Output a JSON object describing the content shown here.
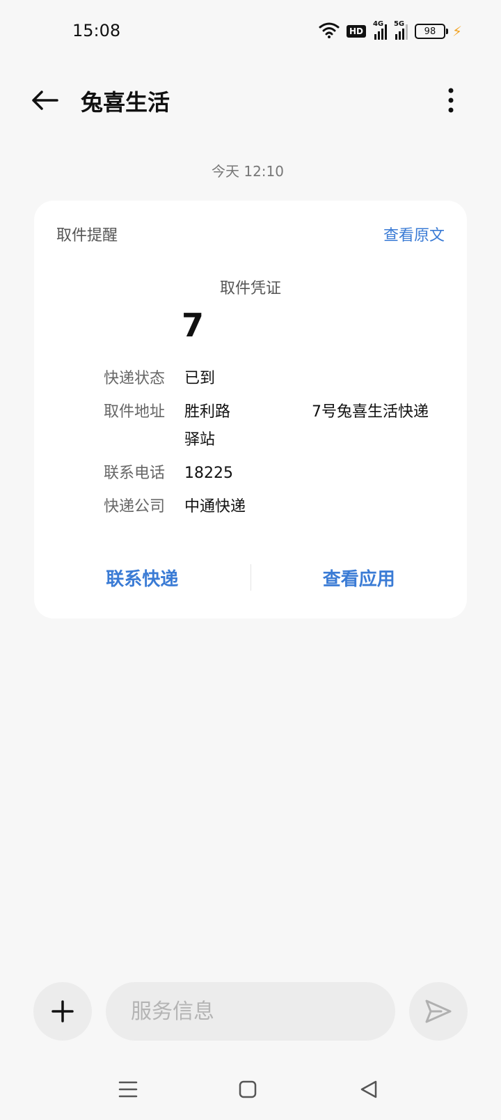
{
  "status_bar": {
    "time": "15:08",
    "hd_label": "HD",
    "network_4g": "4G",
    "network_5g": "5G",
    "battery_level": "98"
  },
  "header": {
    "title": "兔喜生活"
  },
  "message": {
    "timestamp": "今天 12:10",
    "card": {
      "type_label": "取件提醒",
      "view_original_label": "查看原文",
      "voucher_label": "取件凭证",
      "voucher_code": "7",
      "rows": [
        {
          "label": "快递状态",
          "value": "已到"
        },
        {
          "label": "取件地址",
          "value": "胜利路　　　　　 7号兔喜生活快递驿站"
        },
        {
          "label": "联系电话",
          "value": "18225"
        },
        {
          "label": "快递公司",
          "value": "中通快递"
        }
      ],
      "actions": {
        "contact_courier": "联系快递",
        "view_app": "查看应用"
      }
    }
  },
  "input_bar": {
    "placeholder": "服务信息"
  },
  "colors": {
    "accent": "#3a7bd5",
    "background": "#f7f7f7",
    "card": "#ffffff",
    "charge": "#f2a323"
  }
}
